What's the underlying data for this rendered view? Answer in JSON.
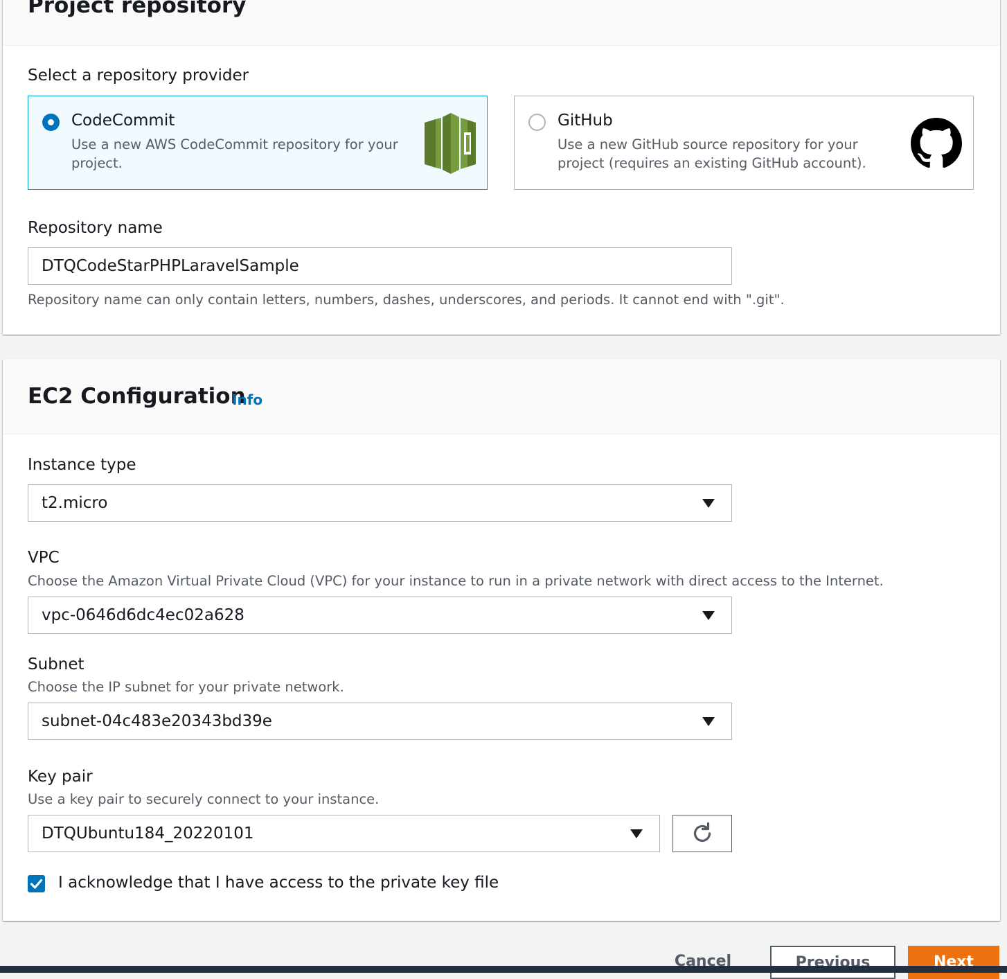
{
  "repository_panel": {
    "title": "Project repository",
    "provider_label": "Select a repository provider",
    "providers": [
      {
        "name": "CodeCommit",
        "description": "Use a new AWS CodeCommit repository for your project.",
        "selected": true,
        "icon": "codecommit-logo-icon"
      },
      {
        "name": "GitHub",
        "description": "Use a new GitHub source repository for your project (requires an existing GitHub account).",
        "selected": false,
        "icon": "github-logo-icon"
      }
    ],
    "repo_name_label": "Repository name",
    "repo_name_value": "DTQCodeStarPHPLaravelSample",
    "repo_name_hint": "Repository name can only contain letters, numbers, dashes, underscores, and periods. It cannot end with \".git\"."
  },
  "ec2_panel": {
    "title": "EC2 Configuration",
    "info_link": "Info",
    "instance_type": {
      "label": "Instance type",
      "value": "t2.micro"
    },
    "vpc": {
      "label": "VPC",
      "description": "Choose the Amazon Virtual Private Cloud (VPC) for your instance to run in a private network with direct access to the Internet.",
      "value": "vpc-0646d6dc4ec02a628"
    },
    "subnet": {
      "label": "Subnet",
      "description": "Choose the IP subnet for your private network.",
      "value": "subnet-04c483e20343bd39e"
    },
    "key_pair": {
      "label": "Key pair",
      "description": "Use a key pair to securely connect to your instance.",
      "value": "DTQUbuntu184_20220101",
      "refresh_icon": "refresh-icon"
    },
    "acknowledge": {
      "label": "I acknowledge that I have access to the private key file",
      "checked": true
    }
  },
  "footer": {
    "cancel_label": "Cancel",
    "previous_label": "Previous",
    "next_label": "Next"
  },
  "colors": {
    "accent": "#0073bb",
    "primary_button": "#ec7211",
    "codecommit_green": "#759c3e",
    "selected_tile_border": "#00a1c9"
  }
}
